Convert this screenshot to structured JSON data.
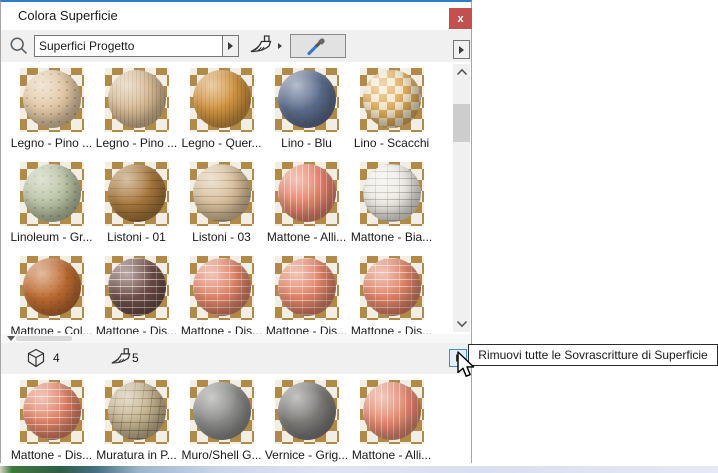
{
  "window": {
    "title": "Colora Superficie",
    "close_label": "x"
  },
  "toolbar": {
    "search_value": "Superfici Progetto"
  },
  "counts": {
    "surfaces": "4",
    "overrides": "5"
  },
  "tooltip": {
    "text": "Rimuovi tutte le Sovrascritture di Superficie"
  },
  "colors": {
    "titlebar_accent": "#2e7cc3",
    "close_button": "#c1504e",
    "toolbar_bg": "#f0f0f0",
    "focus_border": "#3d8ee0",
    "checker_tan": "#b08a46",
    "checker_cream": "#f2eee4"
  },
  "materials": {
    "upper": [
      {
        "label": "Legno - Pino ...",
        "color": "#e3c9a6",
        "pattern": "speckle"
      },
      {
        "label": "Legno - Pino ...",
        "color": "#d9bd97",
        "pattern": "grain"
      },
      {
        "label": "Legno - Quer...",
        "color": "#d4953f",
        "pattern": "grain"
      },
      {
        "label": "Lino - Blu",
        "color": "#5c6e90",
        "pattern": "speckle"
      },
      {
        "label": "Lino - Scacchi",
        "color": "#f3e7c9",
        "color2": "#e0ab5c",
        "pattern": "checker"
      },
      {
        "label": "Linoleum - Gr...",
        "color": "#bac4a5",
        "pattern": "speckle"
      },
      {
        "label": "Listoni - 01",
        "color": "#aa7a3e",
        "pattern": "rings"
      },
      {
        "label": "Listoni - 03",
        "color": "#dac09c",
        "pattern": "rings"
      },
      {
        "label": "Mattone - Alli...",
        "color": "#e8816a",
        "pattern": "vlines"
      },
      {
        "label": "Mattone - Bia...",
        "color": "#f0ede7",
        "pattern": "brick-dark"
      },
      {
        "label": "Mattone - Col...",
        "color": "#c06c31",
        "pattern": "speckle"
      },
      {
        "label": "Mattone - Dis...",
        "color": "#6f4d47",
        "pattern": "brick"
      },
      {
        "label": "Mattone - Dis...",
        "color": "#e18266",
        "pattern": "brick"
      },
      {
        "label": "Mattone - Dis...",
        "color": "#e18266",
        "pattern": "brick"
      },
      {
        "label": "Mattone - Dis...",
        "color": "#e18266",
        "pattern": "brick"
      }
    ],
    "lower": [
      {
        "label": "Mattone - Dis...",
        "color": "#e18266",
        "pattern": "brick"
      },
      {
        "label": "Muratura in P...",
        "color": "#c6b591",
        "pattern": "stone"
      },
      {
        "label": "Muro/Shell G...",
        "color": "#8d8d8b",
        "pattern": "plain"
      },
      {
        "label": "Vernice - Grig...",
        "color": "#7f7d7a",
        "pattern": "plain"
      },
      {
        "label": "Mattone - Alli...",
        "color": "#e68b70",
        "pattern": "vlines"
      }
    ]
  }
}
